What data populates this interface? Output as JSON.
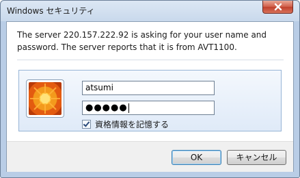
{
  "window": {
    "title": "Windows セキュリティ"
  },
  "message": {
    "line1": "The server 220.157.222.92 is asking for your user name and",
    "line2": "password. The server reports that it is from AVT1100."
  },
  "credentials": {
    "username": "atsumi",
    "password_masked": "●●●●●",
    "remember_label": "資格情報を記憶する",
    "remember_checked": true
  },
  "buttons": {
    "ok": "OK",
    "cancel": "キャンセル"
  }
}
